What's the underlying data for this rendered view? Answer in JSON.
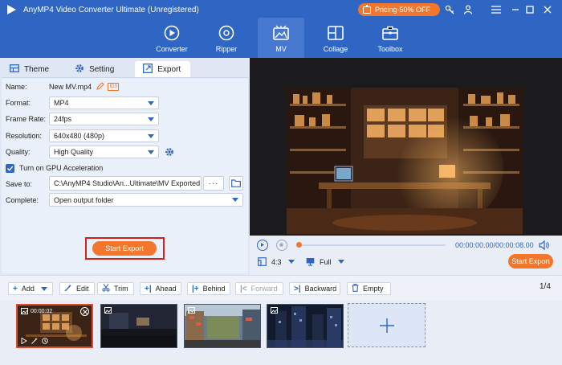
{
  "app": {
    "title": "AnyMP4 Video Converter Ultimate (Unregistered)",
    "pricing_label": "Pricing-50% OFF"
  },
  "nav": [
    {
      "label": "Converter",
      "icon": "converter-icon"
    },
    {
      "label": "Ripper",
      "icon": "ripper-icon"
    },
    {
      "label": "MV",
      "icon": "mv-icon"
    },
    {
      "label": "Collage",
      "icon": "collage-icon"
    },
    {
      "label": "Toolbox",
      "icon": "toolbox-icon"
    }
  ],
  "tabs": {
    "theme": "Theme",
    "setting": "Setting",
    "export": "Export"
  },
  "export": {
    "name_label": "Name:",
    "name_value": "New MV.mp4",
    "format_label": "Format:",
    "format_value": "MP4",
    "framerate_label": "Frame Rate:",
    "framerate_value": "24fps",
    "resolution_label": "Resolution:",
    "resolution_value": "640x480 (480p)",
    "quality_label": "Quality:",
    "quality_value": "High Quality",
    "gpu_label": "Turn on GPU Acceleration",
    "gpu_checked": true,
    "saveto_label": "Save to:",
    "saveto_value": "C:\\AnyMP4 Studio\\An...Ultimate\\MV Exported",
    "complete_label": "Complete:",
    "complete_value": "Open output folder",
    "start_export_label": "Start Export"
  },
  "player": {
    "time": "00:00:00.00/00:00:08.00",
    "ratio": "4:3",
    "mode": "Full",
    "export_label": "Start Export",
    "progress": 0
  },
  "toolbar": {
    "add": "Add",
    "edit": "Edit",
    "trim": "Trim",
    "ahead": "Ahead",
    "behind": "Behind",
    "forward": "Forward",
    "backward": "Backward",
    "empty": "Empty",
    "page": "1/4"
  },
  "clips": [
    {
      "duration": "00:00:02",
      "selected": true
    },
    {
      "duration": "",
      "selected": false
    },
    {
      "duration": "",
      "selected": false
    },
    {
      "duration": "",
      "selected": false
    }
  ],
  "colors": {
    "brand_blue": "#2f66c4",
    "accent_orange": "#f2762b",
    "highlight_red": "#d62020"
  }
}
